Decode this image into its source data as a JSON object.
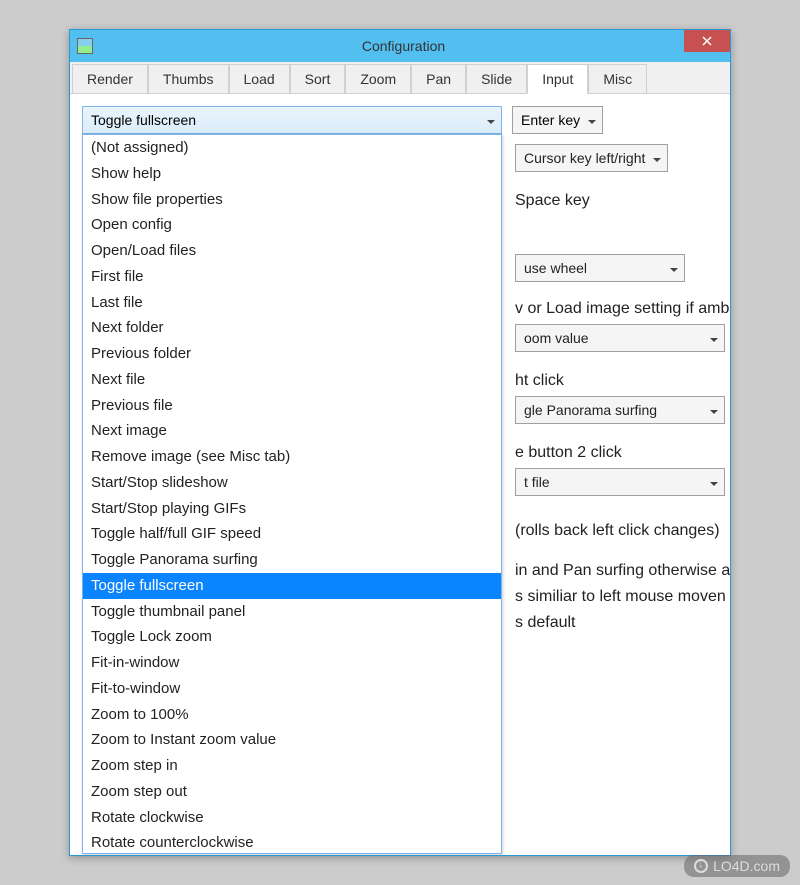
{
  "window": {
    "title": "Configuration"
  },
  "tabs": [
    "Render",
    "Thumbs",
    "Load",
    "Sort",
    "Zoom",
    "Pan",
    "Slide",
    "Input",
    "Misc"
  ],
  "active_tab": "Input",
  "main_dropdown": {
    "value": "Toggle fullscreen",
    "options": [
      "(Not assigned)",
      "Show help",
      "Show file properties",
      "Open config",
      "Open/Load files",
      "First file",
      "Last file",
      "Next folder",
      "Previous folder",
      "Next file",
      "Previous file",
      "Next image",
      "Remove image (see Misc tab)",
      "Start/Stop slideshow",
      "Start/Stop playing GIFs",
      "Toggle half/full GIF speed",
      "Toggle Panorama surfing",
      "Toggle fullscreen",
      "Toggle thumbnail panel",
      "Toggle Lock zoom",
      "Fit-in-window",
      "Fit-to-window",
      "Zoom to 100%",
      "Zoom to Instant zoom value",
      "Zoom step in",
      "Zoom step out",
      "Rotate clockwise",
      "Rotate counterclockwise"
    ]
  },
  "right_selects": {
    "enter_key": "Enter key",
    "cursor_key": "Cursor key left/right",
    "space_label": "Space key",
    "wheel": "use wheel",
    "load_label": "v or Load image setting if amb",
    "zoom_value": "oom value",
    "right_click_label": "ht click",
    "panorama": "gle Panorama surfing",
    "button2_label": "e button 2 click",
    "tfile": "t file",
    "text1": "(rolls back left click changes)",
    "text2": "in and Pan surfing otherwise as",
    "text3": "s similiar to left mouse moven",
    "text4": "s default"
  },
  "watermark": "LO4D.com"
}
